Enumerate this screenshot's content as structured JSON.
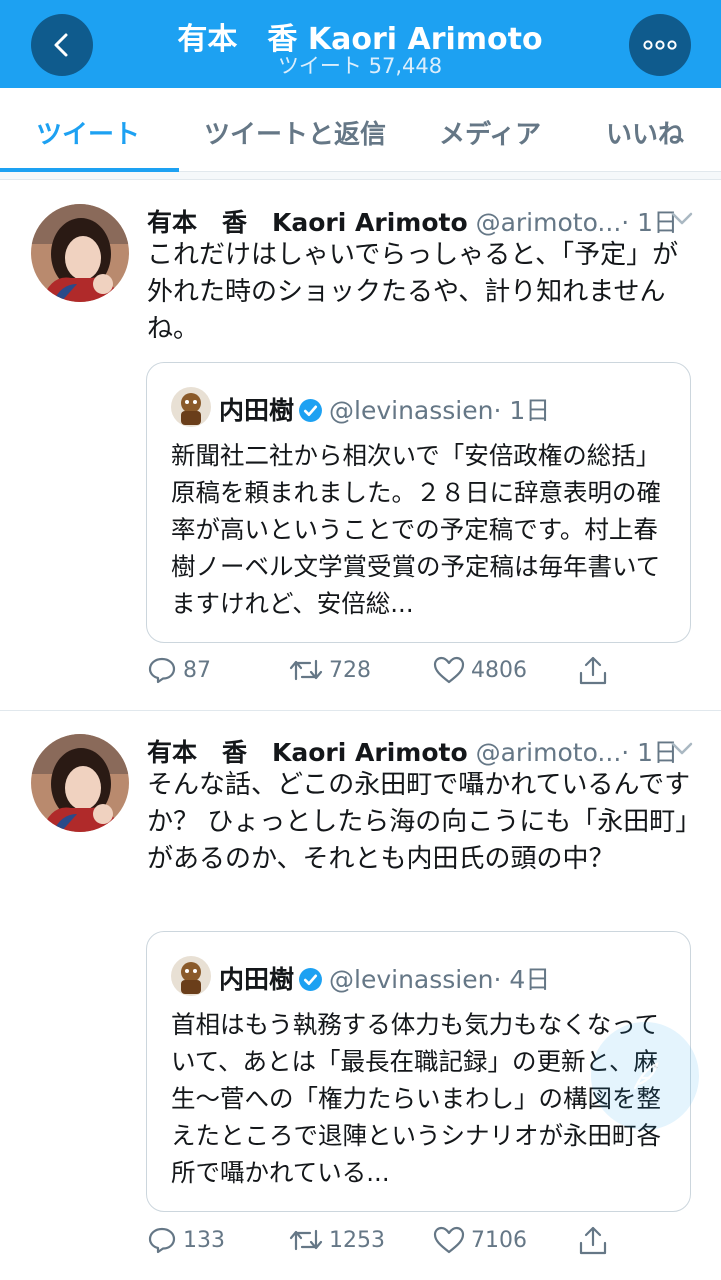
{
  "header": {
    "title": "有本　香  Kaori Arimoto",
    "subtitle": "ツイート 57,448"
  },
  "tabs": [
    {
      "label": "ツイート",
      "active": true
    },
    {
      "label": "ツイートと返信",
      "active": false
    },
    {
      "label": "メディア",
      "active": false
    },
    {
      "label": "いいね",
      "active": false
    }
  ],
  "tweets": [
    {
      "name": "有本　香　Kaori Arimoto",
      "handle": "@arimoto...",
      "time": "· 1日",
      "text": "これだけはしゃいでらっしゃると、「予定」が外れた時のショックたるや、計り知れませんね。",
      "quote": {
        "name": "内田樹",
        "handle": "@levinassien",
        "time": "· 1日",
        "text": "新聞社二社から相次いで「安倍政権の総括」原稿を頼まれました。２８日に辞意表明の確率が高いということでの予定稿です。村上春樹ノーベル文学賞受賞の予定稿は毎年書いてますけれど、安倍総..."
      },
      "replies": "87",
      "retweets": "728",
      "likes": "4806"
    },
    {
      "name": "有本　香　Kaori Arimoto",
      "handle": "@arimoto...",
      "time": "· 1日",
      "text": "そんな話、どこの永田町で囁かれているんですか？ ひょっとしたら海の向こうにも「永田町」があるのか、それとも内田氏の頭の中？",
      "quote": {
        "name": "内田樹",
        "handle": "@levinassien",
        "time": "· 4日",
        "text": "首相はもう執務する体力も気力もなくなっていて、あとは「最長在職記録」の更新と、麻生〜菅への「権力たらいまわし」の構図を整えたところで退陣というシナリオが永田町各所で囁かれている..."
      },
      "replies": "133",
      "retweets": "1253",
      "likes": "7106"
    }
  ],
  "colors": {
    "brand": "#1da1f2",
    "header_button": "#0f5b8d",
    "secondary_text": "#657786",
    "border": "#e1e8ed"
  },
  "icons": {
    "back": "back-arrow-icon",
    "more": "more-dots-icon",
    "reply": "reply-icon",
    "retweet": "retweet-icon",
    "like": "heart-icon",
    "share": "share-icon",
    "verified": "verified-badge-icon",
    "compose": "compose-feather-icon"
  }
}
